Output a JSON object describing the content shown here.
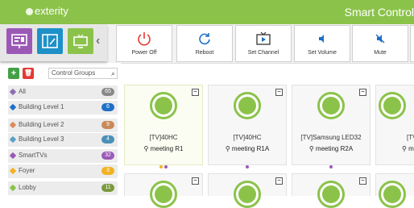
{
  "header": {
    "logo": "exterity",
    "title": "Smart Control"
  },
  "launcher": {
    "items": [
      {
        "icon": "presentation-icon",
        "color": "#9b59b6"
      },
      {
        "icon": "layout-icon",
        "color": "#1e90c8"
      },
      {
        "icon": "tv-icon",
        "color": "#8bc34a"
      }
    ],
    "collapse": "‹"
  },
  "actions": [
    {
      "label": "Power Off",
      "icon": "power-icon"
    },
    {
      "label": "Reboot",
      "icon": "refresh-icon"
    },
    {
      "label": "Set Channel",
      "icon": "tv-play-icon"
    },
    {
      "label": "Set Volume",
      "icon": "volume-icon"
    },
    {
      "label": "Mute",
      "icon": "mute-icon"
    }
  ],
  "sidebar": {
    "search_placeholder": "Control Groups",
    "add_label": "+",
    "delete_label": "🗑",
    "groups": [
      {
        "label": "All",
        "count": "65",
        "color": "#888888",
        "icon_color": "#8e6fb0"
      },
      {
        "label": "Building Level 1",
        "count": "6",
        "color": "#1e6fc8",
        "icon_color": "#1e6fc8"
      },
      {
        "label": "Building Level 2",
        "count": "9",
        "color": "#c98a57",
        "icon_color": "#d98b5c"
      },
      {
        "label": "Building Level 3",
        "count": "4",
        "color": "#4a90b8",
        "icon_color": "#5aa0c8"
      },
      {
        "label": "SmartTVs",
        "count": "32",
        "color": "#9b59b6",
        "icon_color": "#9b59b6"
      },
      {
        "label": "Foyer",
        "count": "3",
        "color": "#f0b323",
        "icon_color": "#f0b323"
      },
      {
        "label": "Lobby",
        "count": "11",
        "color": "#7a9a3e",
        "icon_color": "#8bc34a"
      }
    ]
  },
  "devices": [
    {
      "name": "[TV]40HC",
      "location": "meeting R1",
      "dots": [
        "#f0b323",
        "#9b59b6"
      ],
      "selected": true
    },
    {
      "name": "[TV]40HC",
      "location": "meeting  R1A",
      "dots": [
        "#9b59b6"
      ],
      "selected": false
    },
    {
      "name": "[TV]Samsung LED32",
      "location": "meeting R2A",
      "dots": [
        "#9b59b6"
      ],
      "selected": false
    },
    {
      "name": "[TV",
      "location": "mee",
      "dots": [],
      "selected": false
    }
  ]
}
